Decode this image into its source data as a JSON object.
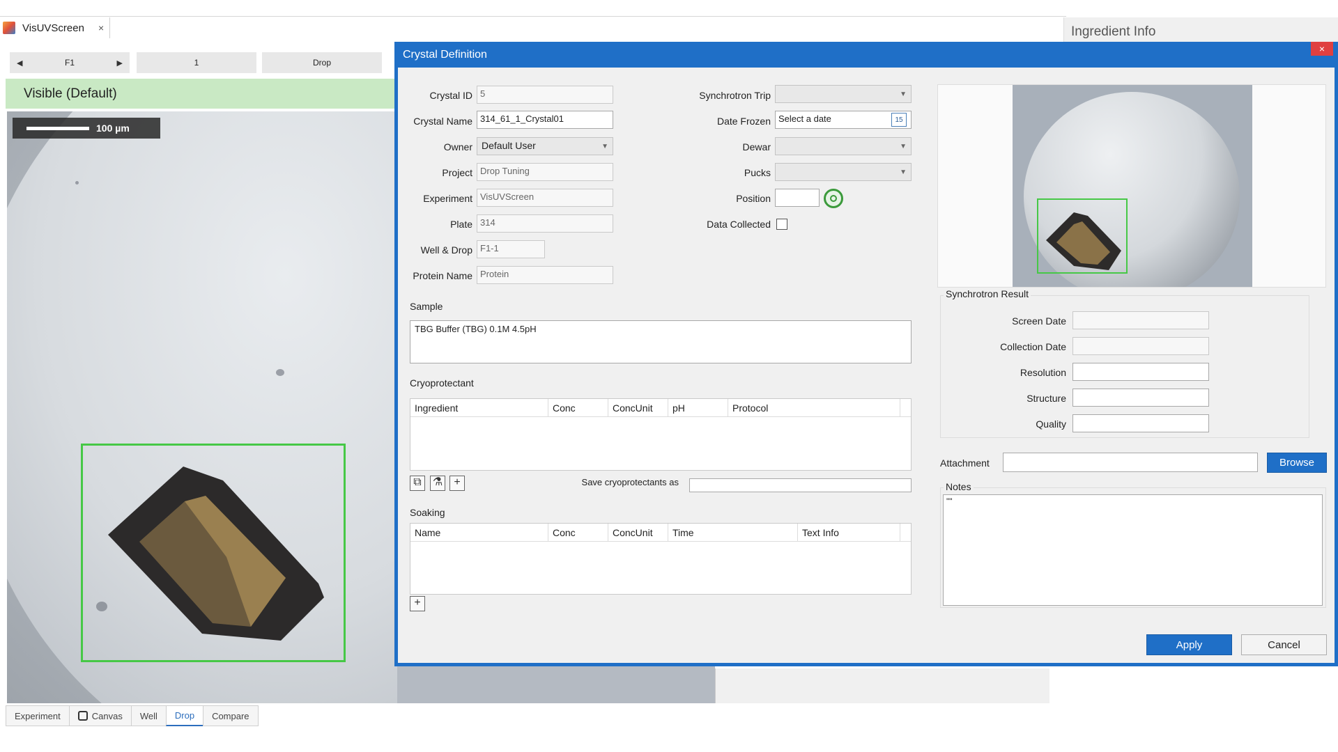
{
  "app": {
    "tab_title": "VisUVScreen",
    "tab_close": "×"
  },
  "ingredient_pane": {
    "title": "Ingredient Info"
  },
  "navigation": {
    "well": "F1",
    "drop_index": "1",
    "drop_label": "Drop",
    "prev_arrow": "◀",
    "next_arrow": "▶"
  },
  "viewer": {
    "header": "Visible (Default)",
    "scale_label": "100 µm"
  },
  "bottom_tabs": [
    {
      "label": "Experiment"
    },
    {
      "label": "Canvas"
    },
    {
      "label": "Well"
    },
    {
      "label": "Drop",
      "active": true
    },
    {
      "label": "Compare"
    }
  ],
  "dialog": {
    "title": "Crystal Definition",
    "close": "×",
    "fields": {
      "crystal_id": {
        "label": "Crystal ID",
        "value": "5"
      },
      "crystal_name": {
        "label": "Crystal Name",
        "value": "314_61_1_Crystal01"
      },
      "owner": {
        "label": "Owner",
        "value": "Default User"
      },
      "project": {
        "label": "Project",
        "value": "Drop Tuning"
      },
      "experiment": {
        "label": "Experiment",
        "value": "VisUVScreen"
      },
      "plate": {
        "label": "Plate",
        "value": "314"
      },
      "well_drop": {
        "label": "Well & Drop",
        "value": "F1-1"
      },
      "protein_name": {
        "label": "Protein Name",
        "value": "Protein"
      }
    },
    "sync": {
      "synchrotron_trip": {
        "label": "Synchrotron Trip",
        "value": ""
      },
      "date_frozen": {
        "label": "Date Frozen",
        "placeholder": "Select a date",
        "calendar_day": "15"
      },
      "dewar": {
        "label": "Dewar",
        "value": ""
      },
      "pucks": {
        "label": "Pucks",
        "value": ""
      },
      "position": {
        "label": "Position",
        "value": ""
      },
      "data_collected": {
        "label": "Data Collected",
        "checked": false
      }
    },
    "sample": {
      "title": "Sample",
      "value": "TBG Buffer (TBG) 0.1M 4.5pH"
    },
    "cryoprotectant": {
      "title": "Cryoprotectant",
      "columns": [
        "Ingredient",
        "Conc",
        "ConcUnit",
        "pH",
        "Protocol"
      ],
      "rows": [],
      "save_label": "Save cryoprotectants as",
      "save_value": ""
    },
    "soaking": {
      "title": "Soaking",
      "columns": [
        "Name",
        "Conc",
        "ConcUnit",
        "Time",
        "Text Info"
      ],
      "rows": []
    },
    "synchrotron_result": {
      "title": "Synchrotron Result",
      "screen_date": {
        "label": "Screen Date",
        "value": ""
      },
      "collection_date": {
        "label": "Collection Date",
        "value": ""
      },
      "resolution": {
        "label": "Resolution",
        "value": ""
      },
      "structure": {
        "label": "Structure",
        "value": ""
      },
      "quality": {
        "label": "Quality",
        "value": ""
      }
    },
    "attachment": {
      "label": "Attachment",
      "value": "",
      "browse_label": "Browse"
    },
    "notes": {
      "title": "Notes",
      "value": "\"\""
    },
    "buttons": {
      "apply": "Apply",
      "cancel": "Cancel"
    }
  },
  "colors": {
    "dialog_accent": "#1f6fc7",
    "selection_box": "#46c846",
    "viewer_header_bg": "#c9e9c4"
  }
}
